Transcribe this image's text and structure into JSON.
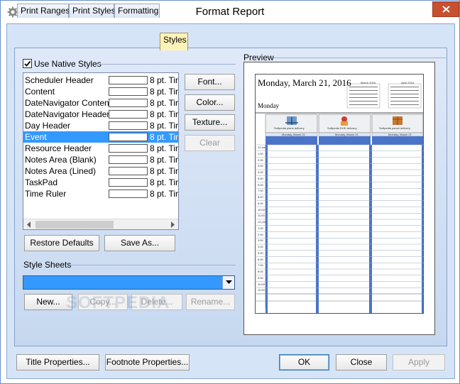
{
  "window": {
    "title": "Format Report"
  },
  "tabs": [
    {
      "label": "Print Ranges"
    },
    {
      "label": "Print Styles"
    },
    {
      "label": "Formatting"
    },
    {
      "label": "Styles"
    }
  ],
  "styles_group": {
    "checkbox_label": "Use Native Styles",
    "checked": true,
    "items": [
      {
        "name": "Scheduler Header",
        "font": "8 pt. Tir"
      },
      {
        "name": "Content",
        "font": "8 pt. Tir"
      },
      {
        "name": "DateNavigator Content",
        "font": "8 pt. Tir"
      },
      {
        "name": "DateNavigator Header",
        "font": "8 pt. Tir"
      },
      {
        "name": "Day Header",
        "font": "8 pt. Tir"
      },
      {
        "name": "Event",
        "font": "8 pt. Tir"
      },
      {
        "name": "Resource Header",
        "font": "8 pt. Tir"
      },
      {
        "name": "Notes Area (Blank)",
        "font": "8 pt. Tir"
      },
      {
        "name": "Notes Area (Lined)",
        "font": "8 pt. Tir"
      },
      {
        "name": "TaskPad",
        "font": "8 pt. Tir"
      },
      {
        "name": "Time Ruler",
        "font": "8 pt. Tir"
      }
    ],
    "selected_item": "Event",
    "side_buttons": {
      "font": "Font...",
      "color": "Color...",
      "texture": "Texture...",
      "clear": "Clear"
    },
    "restore_defaults": "Restore Defaults",
    "save_as": "Save As..."
  },
  "style_sheets": {
    "label": "Style Sheets",
    "selected_value": "",
    "buttons": {
      "new": "New...",
      "copy": "Copy...",
      "delete": "Delete...",
      "rename": "Rename..."
    }
  },
  "preview": {
    "label": "Preview",
    "date_title": "Monday, March 21, 2016",
    "day_label": "Monday",
    "mini_months": [
      "March 2016",
      "April 2016"
    ],
    "resources": [
      "Softpedia plane delivery",
      "Softpedia DHD delivery",
      "Softpedia parcel delivery"
    ],
    "resource_date": "Monday, March 21",
    "time_labels": [
      "12 am",
      "1:00",
      "2:00",
      "3:00",
      "4:00",
      "5:00",
      "6:00",
      "7:00",
      "8:00",
      "9:00",
      "10:00",
      "11:00",
      "12 pm",
      "1:00",
      "2:00",
      "3:00",
      "4:00",
      "5:00",
      "6:00",
      "7:00",
      "8:00",
      "9:00",
      "10:00",
      "11:00"
    ]
  },
  "footer": {
    "title_properties": "Title Properties...",
    "footnote_properties": "Footnote Properties...",
    "ok": "OK",
    "close": "Close",
    "apply": "Apply"
  },
  "watermark": "SOFTPEDIA",
  "colors": {
    "accent": "#3399ff",
    "panel": "#d6e4f7",
    "active_tab": "#fdf3b8",
    "close_button": "#c7502f"
  }
}
